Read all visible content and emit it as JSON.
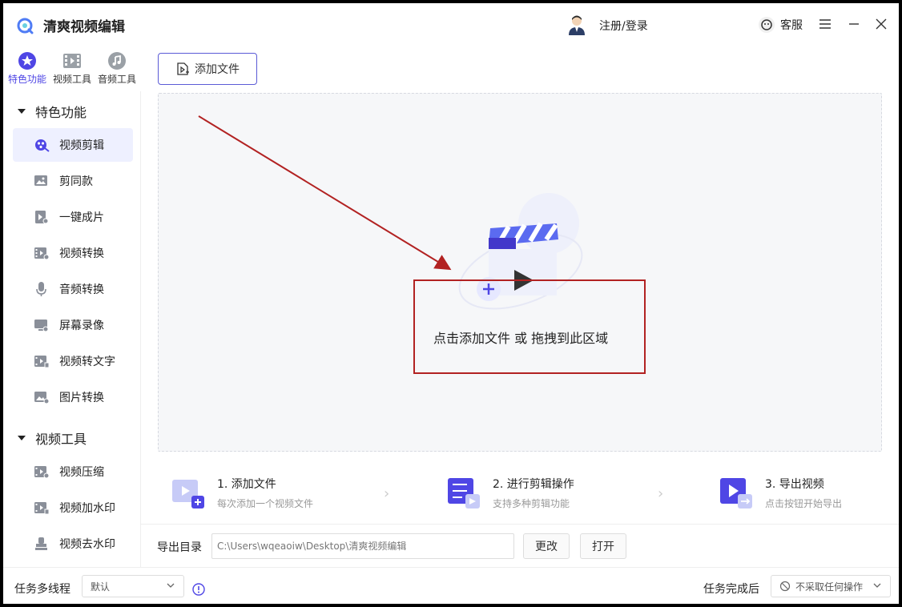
{
  "app": {
    "title": "清爽视频编辑"
  },
  "header": {
    "login_label": "注册/登录",
    "service_label": "客服"
  },
  "tabs": [
    {
      "label": "特色功能",
      "icon": "star-icon",
      "active": true
    },
    {
      "label": "视频工具",
      "icon": "video-icon",
      "active": false
    },
    {
      "label": "音频工具",
      "icon": "music-icon",
      "active": false
    }
  ],
  "sidebar": {
    "sections": [
      {
        "title": "特色功能",
        "items": [
          {
            "label": "视频剪辑",
            "icon": "film-reel-icon",
            "active": true
          },
          {
            "label": "剪同款",
            "icon": "image-icon"
          },
          {
            "label": "一键成片",
            "icon": "play-doc-icon"
          },
          {
            "label": "视频转换",
            "icon": "video-convert-icon"
          },
          {
            "label": "音频转换",
            "icon": "mic-icon"
          },
          {
            "label": "屏幕录像",
            "icon": "screen-record-icon"
          },
          {
            "label": "视频转文字",
            "icon": "video-text-icon"
          },
          {
            "label": "图片转换",
            "icon": "image-convert-icon"
          }
        ]
      },
      {
        "title": "视频工具",
        "items": [
          {
            "label": "视频压缩",
            "icon": "video-compress-icon"
          },
          {
            "label": "视频加水印",
            "icon": "watermark-add-icon"
          },
          {
            "label": "视频去水印",
            "icon": "watermark-remove-icon"
          }
        ]
      }
    ]
  },
  "main": {
    "add_file_label": "添加文件",
    "drop_hint": "点击添加文件 或 拖拽到此区域"
  },
  "steps": [
    {
      "title": "1. 添加文件",
      "subtitle": "每次添加一个视频文件"
    },
    {
      "title": "2. 进行剪辑操作",
      "subtitle": "支持多种剪辑功能"
    },
    {
      "title": "3. 导出视频",
      "subtitle": "点击按钮开始导出"
    }
  ],
  "export": {
    "label": "导出目录",
    "path": "C:\\Users\\wqeaoiw\\Desktop\\清爽视频编辑",
    "change_label": "更改",
    "open_label": "打开"
  },
  "footer": {
    "threads_label": "任务多线程",
    "threads_value": "默认",
    "after_label": "任务完成后",
    "after_value": "不采取任何操作"
  },
  "colors": {
    "accent": "#4f46e5",
    "annotation": "#b22222"
  }
}
